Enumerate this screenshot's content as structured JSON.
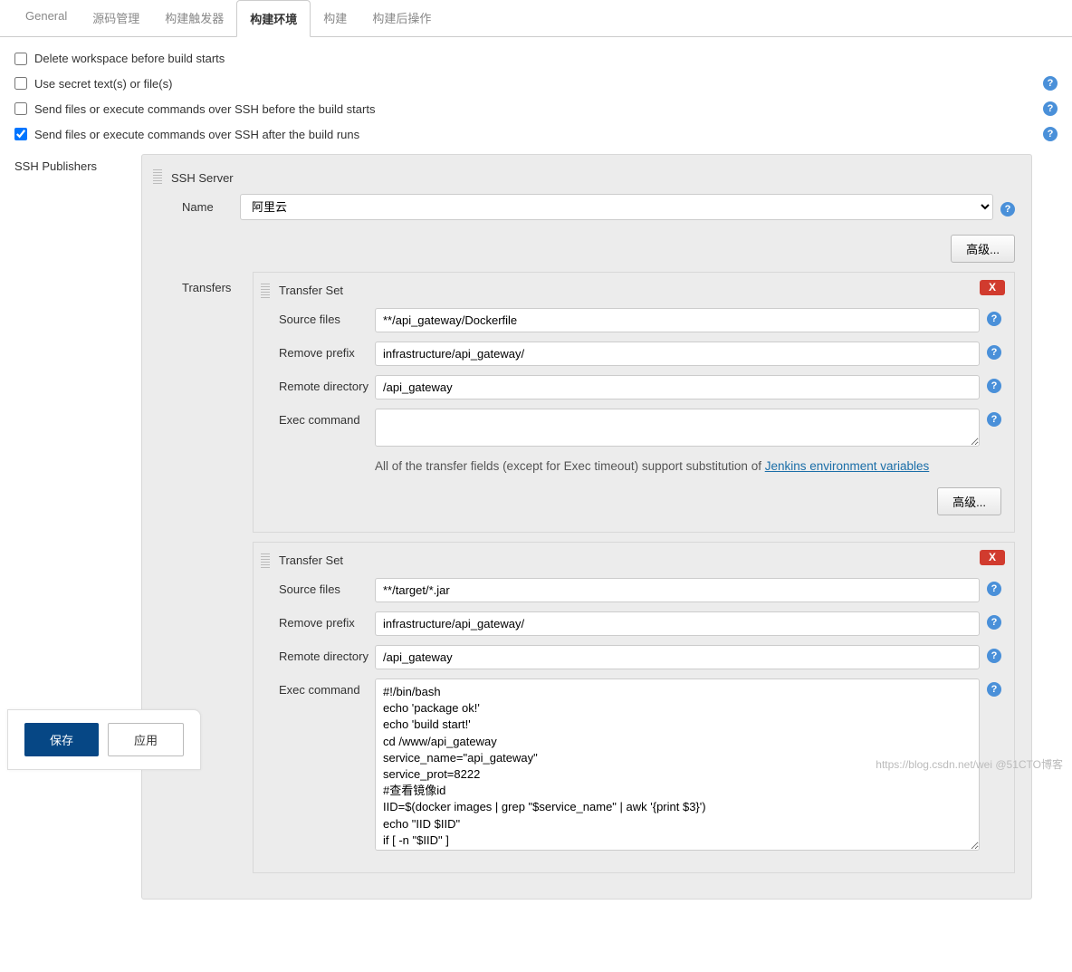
{
  "tabs": [
    "General",
    "源码管理",
    "构建触发器",
    "构建环境",
    "构建",
    "构建后操作"
  ],
  "active_tab_index": 3,
  "checks": {
    "c1": "Delete workspace before build starts",
    "c2": "Use secret text(s) or file(s)",
    "c3": "Send files or execute commands over SSH before the build starts",
    "c4": "Send files or execute commands over SSH after the build runs"
  },
  "ssh_publishers_label": "SSH Publishers",
  "ssh_server_label": "SSH Server",
  "name_label": "Name",
  "server_name_value": "阿里云",
  "advanced_btn": "高级...",
  "transfers_label": "Transfers",
  "transfer_set_label": "Transfer Set",
  "fields": {
    "source_files": "Source files",
    "remove_prefix": "Remove prefix",
    "remote_dir": "Remote directory",
    "exec_cmd": "Exec command"
  },
  "tset1": {
    "source_files": "**/api_gateway/Dockerfile",
    "remove_prefix": "infrastructure/api_gateway/",
    "remote_dir": "/api_gateway",
    "exec_cmd": ""
  },
  "help_note_prefix": "All of the transfer fields (except for Exec timeout) support substitution of ",
  "help_note_link": "Jenkins environment variables",
  "tset2": {
    "source_files": "**/target/*.jar",
    "remove_prefix": "infrastructure/api_gateway/",
    "remote_dir": "/api_gateway",
    "exec_cmd": "#!/bin/bash\necho 'package ok!'\necho 'build start!'\ncd /www/api_gateway\nservice_name=\"api_gateway\"\nservice_prot=8222\n#查看镜像id\nIID=$(docker images | grep \"$service_name\" | awk '{print $3}')\necho \"IID $IID\"\nif [ -n \"$IID\" ]\nthen\n    echo \"exist $SERVER_NAME image,IID=$IID\"\n    #删除镜像\n    docker rmi -f $service_name"
  },
  "footer": {
    "save": "保存",
    "apply": "应用"
  },
  "watermark": "https://blog.csdn.net/wei @51CTO博客"
}
